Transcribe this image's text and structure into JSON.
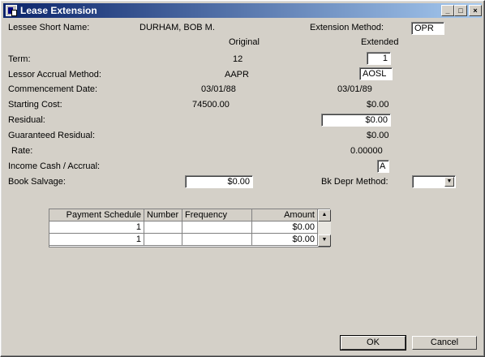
{
  "window": {
    "title": "Lease Extension",
    "min": "_",
    "max": "□",
    "close": "×"
  },
  "labels": {
    "lessee_short_name": "Lessee Short Name:",
    "extension_method": "Extension Method:",
    "original": "Original",
    "extended": "Extended",
    "term": "Term:",
    "lessor_accrual_method": "Lessor Accrual Method:",
    "commencement_date": "Commencement Date:",
    "starting_cost": "Starting Cost:",
    "residual": "Residual:",
    "guaranteed_residual": "Guaranteed Residual:",
    "rate": "Rate:",
    "income_cash_accrual": "Income Cash / Accrual:",
    "book_salvage": "Book Salvage:",
    "bk_depr_method": "Bk Depr Method:"
  },
  "values": {
    "lessee_name": "DURHAM, BOB M.",
    "extension_method": "OPR",
    "term_original": "12",
    "term_extended": "1",
    "accrual_original": "AAPR",
    "accrual_extended": "AOSL",
    "commencement_original": "03/01/88",
    "commencement_extended": "03/01/89",
    "starting_cost_original": "74500.00",
    "starting_cost_extended": "$0.00",
    "residual_extended": "$0.00",
    "guaranteed_residual_extended": "$0.00",
    "rate_extended": "0.00000",
    "income_cash_accrual": "A",
    "book_salvage": "$0.00",
    "bk_depr_method": ""
  },
  "grid": {
    "columns": [
      "Payment Schedule",
      "Number",
      "Frequency",
      "Amount"
    ],
    "rows": [
      [
        "1",
        "",
        "",
        "$0.00"
      ],
      [
        "1",
        "",
        "",
        "$0.00"
      ]
    ]
  },
  "buttons": {
    "ok": "OK",
    "cancel": "Cancel"
  },
  "icons": {
    "scroll_up": "▲",
    "scroll_down": "▼",
    "dropdown": "▼"
  }
}
